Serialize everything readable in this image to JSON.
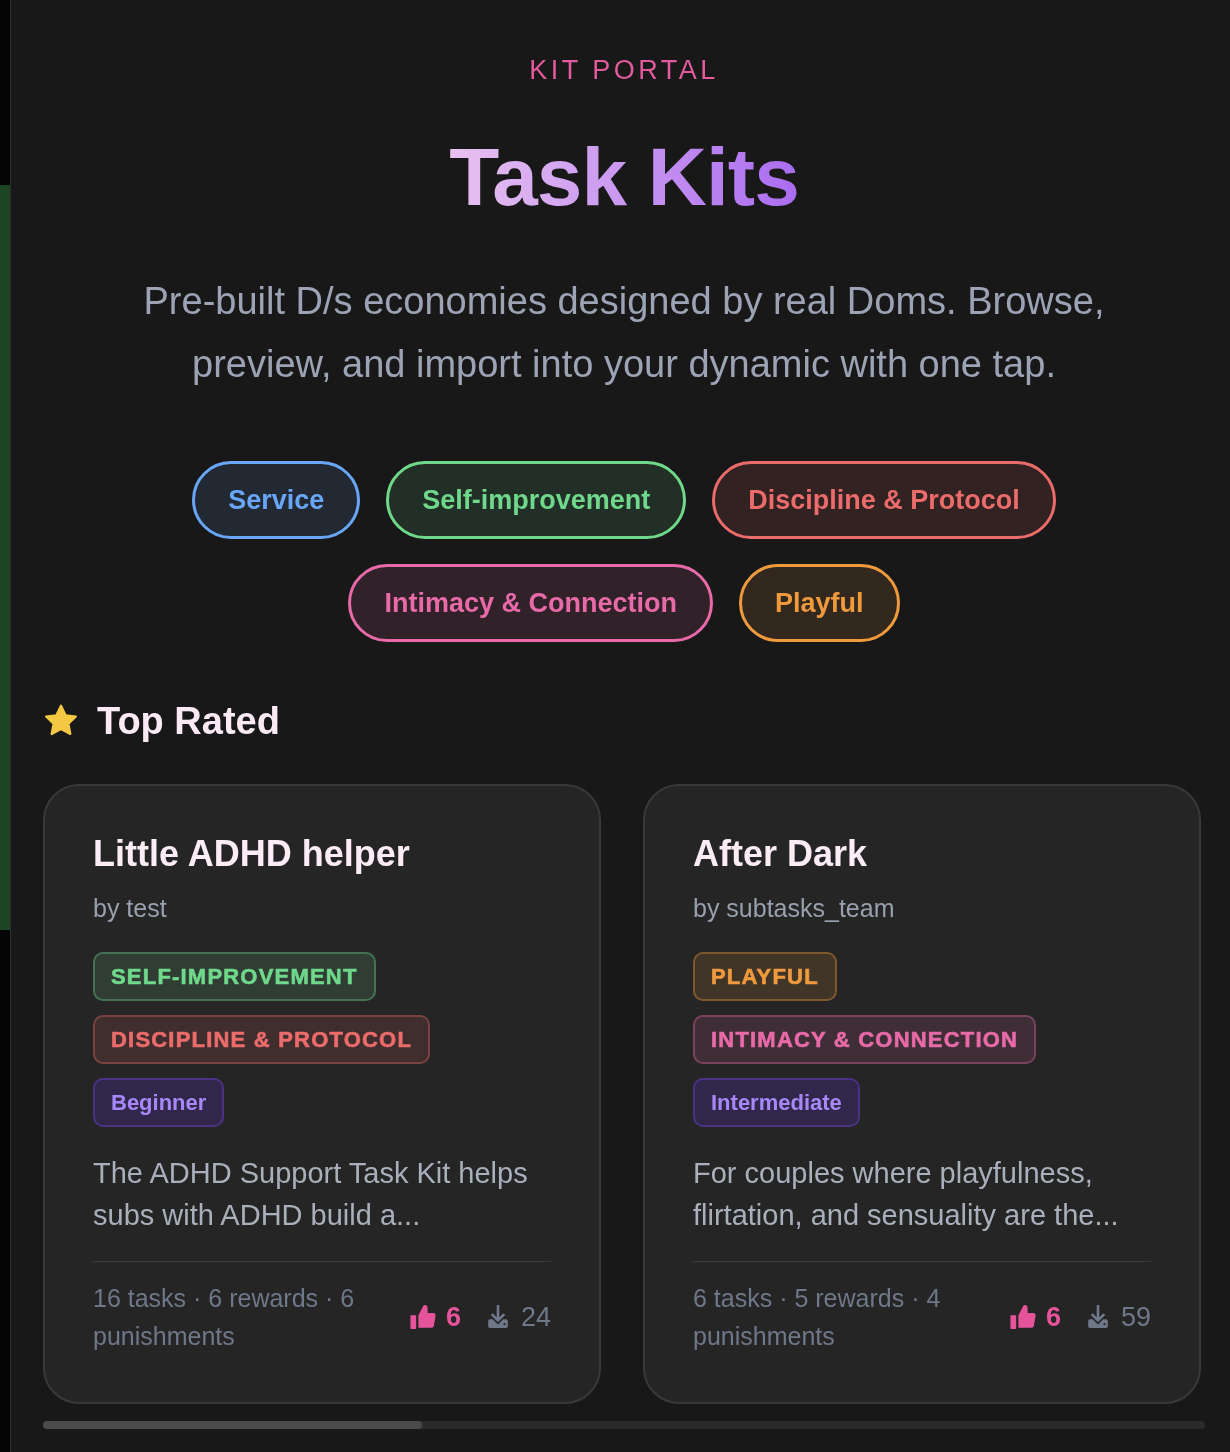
{
  "header": {
    "eyebrow": "KIT PORTAL",
    "title": "Task Kits",
    "subtitle": "Pre-built D/s economies designed by real Doms. Browse, preview, and import into your dynamic with one tap."
  },
  "categories": [
    {
      "label": "Service",
      "color": "#6aa6f8"
    },
    {
      "label": "Self-improvement",
      "color": "#6fd88b"
    },
    {
      "label": "Discipline & Protocol",
      "color": "#ec6b6b"
    },
    {
      "label": "Intimacy & Connection",
      "color": "#e86aa8"
    },
    {
      "label": "Playful",
      "color": "#f09a3e"
    }
  ],
  "section": {
    "title": "Top Rated"
  },
  "kits": [
    {
      "title": "Little ADHD helper",
      "author": "by test",
      "tags": [
        {
          "label": "SELF-IMPROVEMENT",
          "color": "#6fd88b"
        },
        {
          "label": "DISCIPLINE & PROTOCOL",
          "color": "#ec6b6b"
        }
      ],
      "difficulty": "Beginner",
      "description": "The ADHD Support Task Kit helps subs with ADHD build a...",
      "stats": "16 tasks · 6 rewards · 6 punishments",
      "likes": "6",
      "downloads": "24"
    },
    {
      "title": "After Dark",
      "author": "by subtasks_team",
      "tags": [
        {
          "label": "PLAYFUL",
          "color": "#f09a3e"
        },
        {
          "label": "INTIMACY & CONNECTION",
          "color": "#e86aa8"
        }
      ],
      "difficulty": "Intermediate",
      "description": "For couples where playfulness, flirtation, and sensuality are the...",
      "stats": "6 tasks · 5 rewards · 4 punishments",
      "likes": "6",
      "downloads": "59"
    }
  ]
}
